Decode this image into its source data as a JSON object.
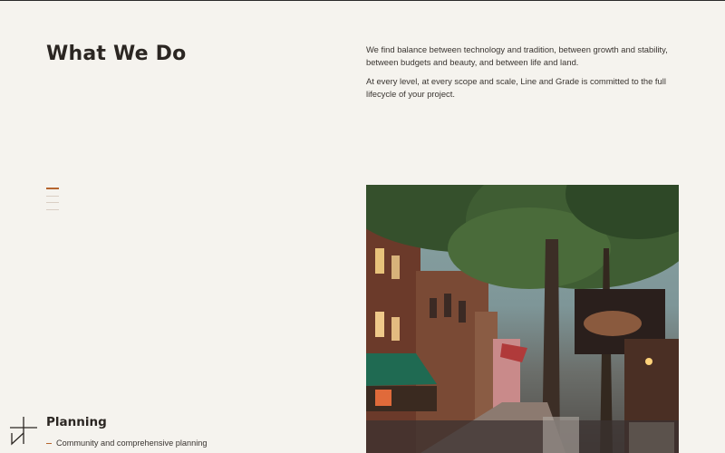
{
  "section": {
    "title": "What We Do",
    "intro_paragraphs": [
      "We find balance between technology and tradition, between growth and stability, between budgets and beauty, and between life and land.",
      "At every level, at every scope and scale, Line and Grade is committed to the full lifecycle of your project."
    ]
  },
  "pager": {
    "total": 4,
    "active_index": 0
  },
  "service": {
    "icon": "planning-line-icon",
    "title": "Planning",
    "subtitle": "Community and comprehensive planning"
  },
  "colors": {
    "background": "#f5f3ee",
    "text": "#2b2622",
    "accent": "#b5652e"
  }
}
